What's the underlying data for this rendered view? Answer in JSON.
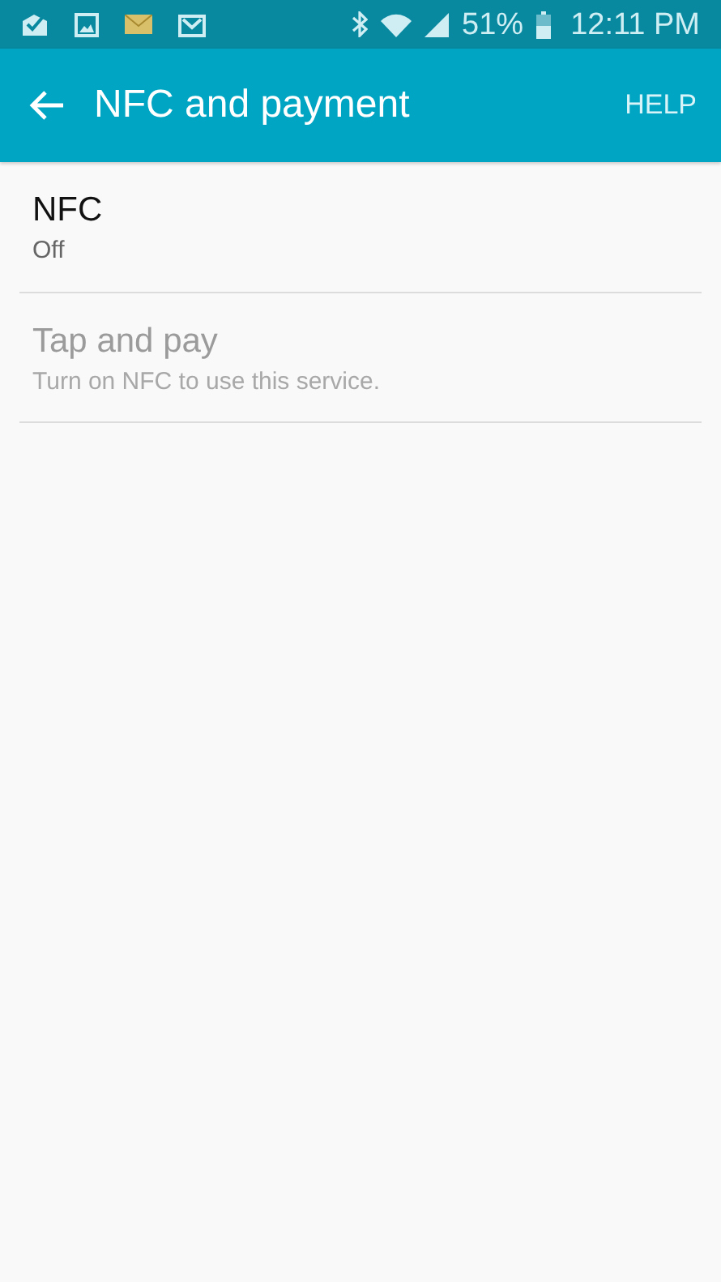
{
  "status_bar": {
    "battery": "51%",
    "time": "12:11 PM"
  },
  "app_bar": {
    "title": "NFC and payment",
    "action": "HELP"
  },
  "settings": [
    {
      "title": "NFC",
      "summary": "Off",
      "disabled": false
    },
    {
      "title": "Tap and pay",
      "summary": "Turn on NFC to use this service.",
      "disabled": true
    }
  ]
}
